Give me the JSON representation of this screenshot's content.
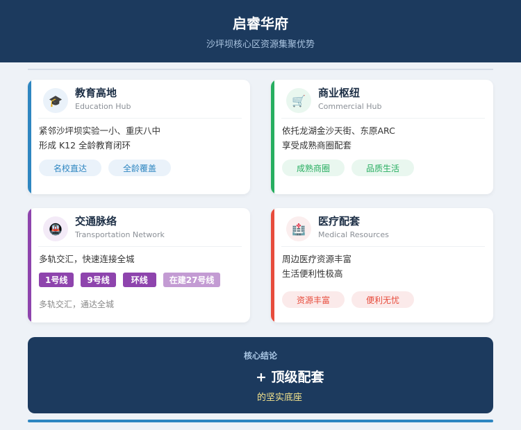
{
  "header": {
    "title": "启睿华府",
    "subtitle": "沙坪坝核心区资源集聚优势"
  },
  "cards": [
    {
      "title": "教育高地",
      "subtitle": "Education Hub",
      "icon": "graduation-cap-icon",
      "color": "#2e86c1",
      "lines": [
        "紧邻沙坪坝实验一小、重庆八中",
        "形成 K12 全龄教育闭环"
      ],
      "tags": [
        "名校直达",
        "全龄覆盖"
      ]
    },
    {
      "title": "商业枢纽",
      "subtitle": "Commercial Hub",
      "icon": "shopping-cart-icon",
      "color": "#27ae60",
      "lines": [
        "依托龙湖金沙天街、东原ARC",
        "享受成熟商圈配套"
      ],
      "tags": [
        "成熟商圈",
        "品质生活"
      ]
    },
    {
      "title": "交通脉络",
      "subtitle": "Transportation Network",
      "icon": "metro-icon",
      "color": "#8e44ad",
      "lines": [
        "多轨交汇，快速连接全城"
      ],
      "metro_lines": [
        "1号线",
        "9号线",
        "环线",
        "在建27号线"
      ],
      "note": "多轨交汇，通达全城"
    },
    {
      "title": "医疗配套",
      "subtitle": "Medical Resources",
      "icon": "hospital-icon",
      "color": "#e74c3c",
      "lines": [
        "周边医疗资源丰富",
        "生活便利性极高"
      ],
      "tags": [
        "资源丰富",
        "便利无忧"
      ]
    }
  ],
  "conclusion": {
    "label": "核心结论",
    "main": "+ 顶级配套",
    "sub": "的坚实底座"
  }
}
